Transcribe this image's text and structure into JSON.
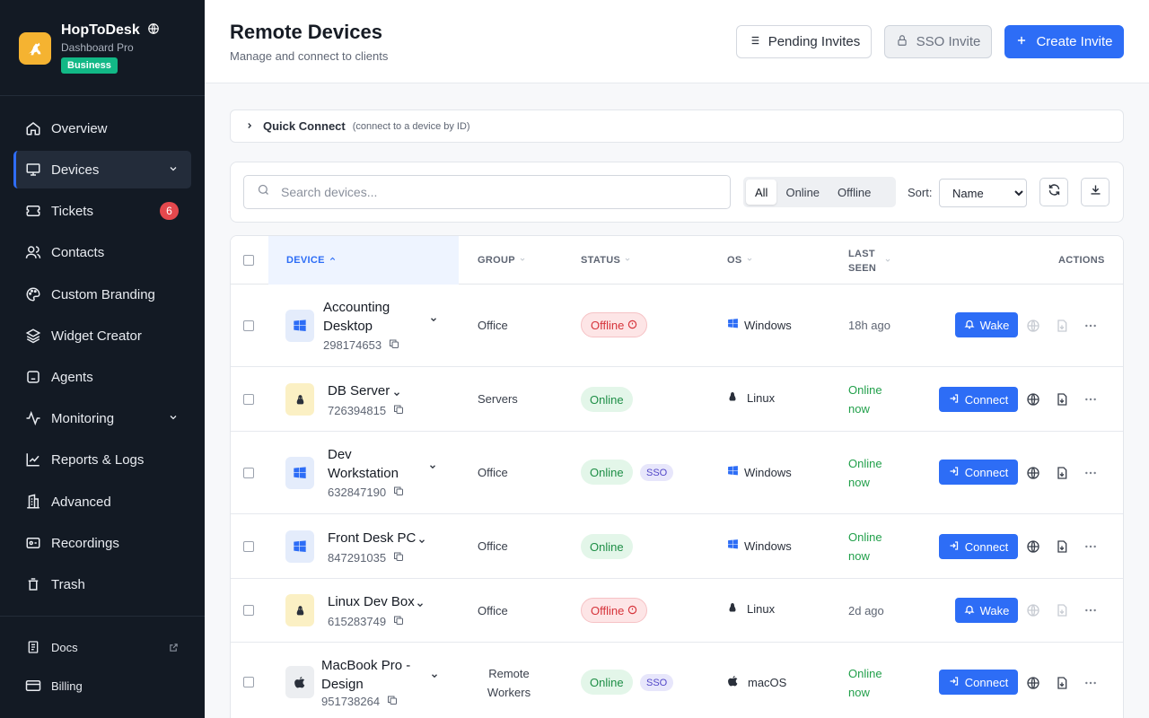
{
  "brand": {
    "name": "HopToDesk",
    "subtitle": "Dashboard Pro",
    "plan_badge": "Business",
    "logo_color": "#f5b331"
  },
  "sidebar": {
    "items": [
      {
        "label": "Overview",
        "icon": "home-icon"
      },
      {
        "label": "Devices",
        "icon": "monitor-icon",
        "active": true,
        "expandable": true
      },
      {
        "label": "Tickets",
        "icon": "ticket-icon",
        "count": "6"
      },
      {
        "label": "Contacts",
        "icon": "users-icon"
      },
      {
        "label": "Custom Branding",
        "icon": "palette-icon"
      },
      {
        "label": "Widget Creator",
        "icon": "layers-icon"
      },
      {
        "label": "Agents",
        "icon": "bot-icon"
      },
      {
        "label": "Monitoring",
        "icon": "activity-icon",
        "expandable": true
      },
      {
        "label": "Reports & Logs",
        "icon": "chart-line-icon"
      },
      {
        "label": "Advanced",
        "icon": "building-icon"
      },
      {
        "label": "Recordings",
        "icon": "recording-icon"
      },
      {
        "label": "Trash",
        "icon": "trash-icon"
      }
    ],
    "footer": [
      {
        "label": "Docs",
        "icon": "document-icon",
        "external": true
      },
      {
        "label": "Billing",
        "icon": "credit-card-icon"
      }
    ]
  },
  "header": {
    "title": "Remote Devices",
    "subtitle": "Manage and connect to clients",
    "pending_invites": "Pending Invites",
    "sso_invite": "SSO Invite",
    "create_invite": "Create Invite"
  },
  "quick_connect": {
    "title": "Quick Connect",
    "hint": "(connect to a device by ID)"
  },
  "filters": {
    "search_placeholder": "Search devices...",
    "segments": [
      "All",
      "Online",
      "Offline"
    ],
    "selected_segment": "All",
    "sort_label": "Sort:",
    "sort_value": "Name"
  },
  "table": {
    "columns": {
      "device": "DEVICE",
      "group": "GROUP",
      "status": "STATUS",
      "os": "OS",
      "last_seen": "LAST SEEN",
      "actions": "ACTIONS"
    },
    "rows": [
      {
        "name": "Accounting Desktop",
        "id": "298174653",
        "group": "Office",
        "status": "Offline",
        "sso": "",
        "os": "Windows",
        "last_seen": "18h ago",
        "action": "Wake"
      },
      {
        "name": "DB Server",
        "id": "726394815",
        "group": "Servers",
        "status": "Online",
        "sso": "",
        "os": "Linux",
        "last_seen": "Online now",
        "action": "Connect"
      },
      {
        "name": "Dev Workstation",
        "id": "632847190",
        "group": "Office",
        "status": "Online",
        "sso": "SSO",
        "os": "Windows",
        "last_seen": "Online now",
        "action": "Connect"
      },
      {
        "name": "Front Desk PC",
        "id": "847291035",
        "group": "Office",
        "status": "Online",
        "sso": "",
        "os": "Windows",
        "last_seen": "Online now",
        "action": "Connect"
      },
      {
        "name": "Linux Dev Box",
        "id": "615283749",
        "group": "Office",
        "status": "Offline",
        "sso": "",
        "os": "Linux",
        "last_seen": "2d ago",
        "action": "Wake"
      },
      {
        "name": "MacBook Pro - Design",
        "id": "951738264",
        "group": "Remote Workers",
        "status": "Online",
        "sso": "SSO",
        "os": "macOS",
        "last_seen": "Online now",
        "action": "Connect"
      }
    ]
  },
  "colors": {
    "accent": "#2d6df6",
    "online": "#1e8e46",
    "offline": "#d6333a",
    "sidebar_bg": "#131a24"
  }
}
